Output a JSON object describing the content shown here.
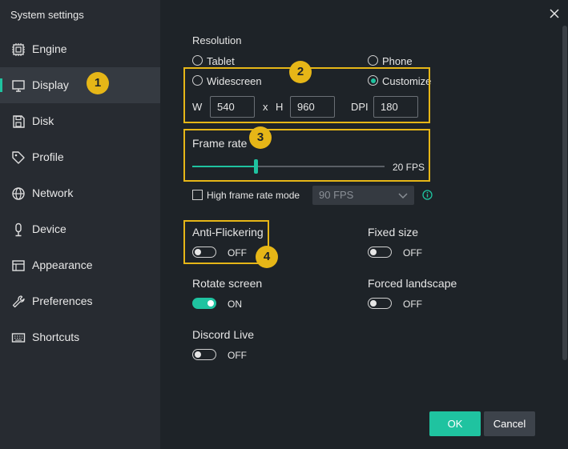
{
  "window": {
    "title": "System settings"
  },
  "sidebar": {
    "items": [
      {
        "label": "Engine",
        "icon": "chip-icon"
      },
      {
        "label": "Display",
        "icon": "monitor-icon",
        "active": true
      },
      {
        "label": "Disk",
        "icon": "floppy-icon"
      },
      {
        "label": "Profile",
        "icon": "tag-icon"
      },
      {
        "label": "Network",
        "icon": "globe-icon"
      },
      {
        "label": "Device",
        "icon": "microphone-icon"
      },
      {
        "label": "Appearance",
        "icon": "window-icon"
      },
      {
        "label": "Preferences",
        "icon": "wrench-icon"
      },
      {
        "label": "Shortcuts",
        "icon": "keyboard-icon"
      }
    ]
  },
  "resolution": {
    "heading": "Resolution",
    "options": {
      "tablet": "Tablet",
      "phone": "Phone",
      "widescreen": "Widescreen",
      "customize": "Customize"
    },
    "selected": "Customize",
    "w_label": "W",
    "w_value": "540",
    "x_label": "x",
    "h_label": "H",
    "h_value": "960",
    "dpi_label": "DPI",
    "dpi_value": "180"
  },
  "frame_rate": {
    "heading": "Frame rate",
    "value_label": "20 FPS",
    "value": 20,
    "level": 0.33,
    "high_mode_label": "High frame rate mode",
    "high_mode_checked": false,
    "high_mode_select": "90 FPS"
  },
  "toggles": {
    "anti_flickering": {
      "label": "Anti-Flickering",
      "state": "OFF"
    },
    "fixed_size": {
      "label": "Fixed size",
      "state": "OFF"
    },
    "rotate_screen": {
      "label": "Rotate screen",
      "state": "ON"
    },
    "forced_landscape": {
      "label": "Forced landscape",
      "state": "OFF"
    },
    "discord_live": {
      "label": "Discord Live",
      "state": "OFF"
    }
  },
  "badges": [
    "1",
    "2",
    "3",
    "4"
  ],
  "buttons": {
    "ok": "OK",
    "cancel": "Cancel"
  },
  "colors": {
    "accent": "#1fc3a0",
    "highlight": "#e6b617"
  }
}
